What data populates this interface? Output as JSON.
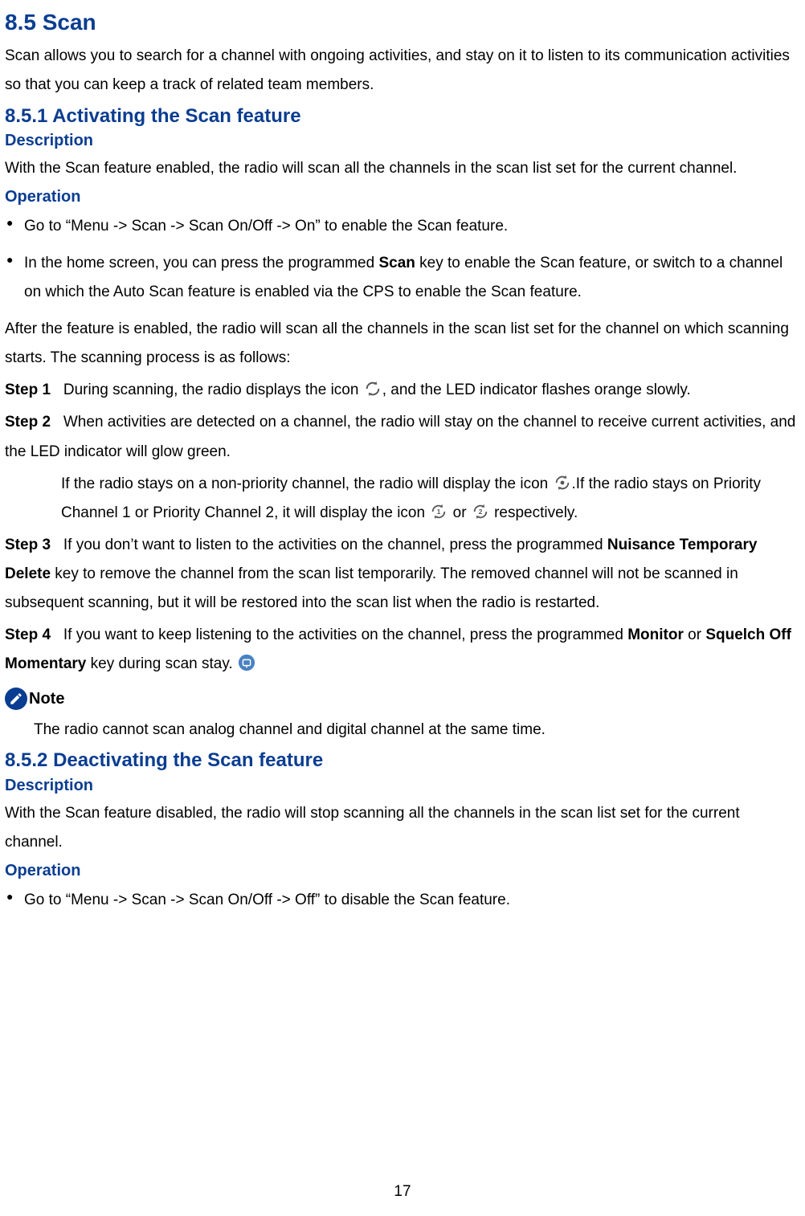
{
  "section": {
    "num": "8.5",
    "title": "Scan",
    "intro": "Scan allows you to search for a channel with ongoing activities, and stay on it to listen to its communication activities so that you can keep a track of related team members."
  },
  "s1": {
    "num": "8.5.1",
    "title": "Activating the Scan feature",
    "desc_h": "Description",
    "desc": "With the Scan feature enabled, the radio will scan all the channels in the scan list set for the current channel.",
    "op_h": "Operation",
    "bullets": [
      "Go to “Menu -> Scan -> Scan On/Off -> On” to enable the Scan feature.",
      "In the home screen, you can press the programmed Scan key to enable the Scan feature, or switch to a channel on which the Auto Scan feature is enabled via the CPS to enable the Scan feature."
    ],
    "bullet2_pre": "In the home screen, you can press the programmed ",
    "bullet2_scan": "Scan",
    "bullet2_post": " key to enable the Scan feature, or switch to a channel on which the Auto Scan feature is enabled via the CPS to enable the Scan feature.",
    "after": "After the feature is enabled, the radio will scan all the channels in the scan list set for the channel on which scanning starts. The scanning process is as follows:",
    "step1_label": "Step 1",
    "step1_a": "During scanning, the radio displays the icon ",
    "step1_b": ", and the LED indicator flashes orange slowly.",
    "step2_label": "Step 2",
    "step2": "When activities are detected on a channel, the radio will stay on the channel to receive current activities, and the LED indicator will glow green.",
    "step2_sub_a": "If the radio stays on a non-priority channel, the radio will display the icon ",
    "step2_sub_b": ".If the radio stays on Priority Channel 1 or Priority Channel 2, it will display the icon ",
    "step2_sub_c": " or ",
    "step2_sub_d": " respectively.",
    "step3_label": "Step 3",
    "step3_a": "If you don’t want to listen to the activities on the channel, press the programmed ",
    "step3_ntd": "Nuisance Temporary Delete",
    "step3_b": " key to remove the channel from the scan list temporarily. The removed channel will not be scanned in subsequent scanning, but it will be restored into the scan list when the radio is restarted.",
    "step4_label": "Step 4",
    "step4_a": "If you want to keep listening to the activities on the channel, press the programmed ",
    "step4_mon": "Monitor",
    "step4_or": " or ",
    "step4_sq": "Squelch Off Momentary",
    "step4_b": " key during scan stay. ",
    "note_label": "Note",
    "note": "The radio cannot scan analog channel and digital channel at the same time."
  },
  "s2": {
    "num": "8.5.2",
    "title": "Deactivating the Scan feature",
    "desc_h": "Description",
    "desc": "With the Scan feature disabled, the radio will stop scanning all the channels in the scan list set for the current channel.",
    "op_h": "Operation",
    "bullet": "Go to “Menu -> Scan -> Scan On/Off -> Off” to disable the Scan feature."
  },
  "page_number": "17"
}
